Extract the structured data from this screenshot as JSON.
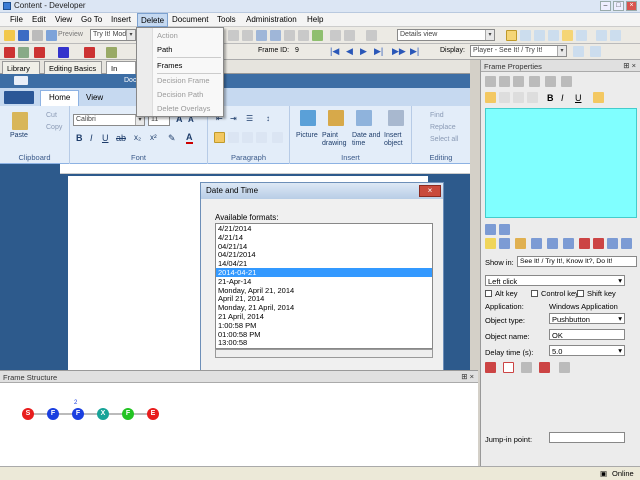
{
  "title": "Content - Developer",
  "menu": [
    "File",
    "Edit",
    "View",
    "Go To",
    "Insert",
    "Delete",
    "Document",
    "Tools",
    "Administration",
    "Help"
  ],
  "delete_menu": {
    "items": [
      {
        "label": "Action",
        "enabled": false
      },
      {
        "label": "Path",
        "enabled": true
      },
      {
        "label": "Frames",
        "enabled": true
      },
      {
        "label": "Decision Frame",
        "enabled": false
      },
      {
        "label": "Decision Path",
        "enabled": false
      },
      {
        "label": "Delete Overlays",
        "enabled": false
      }
    ]
  },
  "toolbar1": {
    "preview_label": "Preview",
    "mode_value": "Try It! Mode",
    "view_value": "Details view"
  },
  "toolbar2": {
    "frame_id_label": "Frame ID:",
    "frame_id_value": "9",
    "display_label": "Display:",
    "display_value": "Player - See It! / Try It!"
  },
  "doc_tabs": [
    "Library",
    "Editing Basics",
    "In"
  ],
  "word": {
    "tabs": [
      "Home",
      "View"
    ],
    "clipboard": {
      "paste": "Paste",
      "cut": "Cut",
      "copy": "Copy",
      "label": "Clipboard"
    },
    "font": {
      "name": "Calibri",
      "size": "11",
      "label": "Font"
    },
    "paragraph": {
      "label": "Paragraph"
    },
    "insert": {
      "picture": "Picture",
      "paint": "Paint drawing",
      "datetime": "Date and time",
      "object": "Insert object",
      "label": "Insert"
    },
    "editing": {
      "find": "Find",
      "replace": "Replace",
      "selectall": "Select all",
      "label": "Editing"
    },
    "doc_tab_label": "Doc"
  },
  "dialog": {
    "title": "Date and Time",
    "label": "Available formats:",
    "formats": [
      "4/21/2014",
      "4/21/14",
      "04/21/14",
      "04/21/2014",
      "14/04/21",
      "2014-04-21",
      "21-Apr-14",
      "Monday, April 21, 2014",
      "April 21, 2014",
      "Monday, 21 April, 2014",
      "21 April, 2014",
      "1:00:58 PM",
      "01:00:58 PM",
      "13:00:58"
    ],
    "selected_index": 5
  },
  "frame_properties": {
    "title": "Frame Properties",
    "show_in_label": "Show in:",
    "show_in_value": "See It! / Try It!, Know It?, Do It!",
    "action_value": "Left click",
    "alt_key": "Alt key",
    "control_key": "Control key",
    "shift_key": "Shift key",
    "application_label": "Application:",
    "application_value": "Windows Application",
    "object_type_label": "Object type:",
    "object_type_value": "Pushbutton",
    "object_name_label": "Object name:",
    "object_name_value": "OK",
    "delay_label": "Delay time (s):",
    "delay_value": "5.0",
    "jump_label": "Jump-in point:",
    "jump_value": ""
  },
  "frame_structure": {
    "title": "Frame Structure",
    "nodes": [
      {
        "label": "S",
        "color": "#e81c1c"
      },
      {
        "label": "F",
        "color": "#1a3fe0"
      },
      {
        "label": "F",
        "color": "#1a3fe0",
        "badge": "2"
      },
      {
        "label": "X",
        "color": "#17a398"
      },
      {
        "label": "F",
        "color": "#22c322"
      },
      {
        "label": "E",
        "color": "#e81c1c"
      }
    ]
  },
  "status": {
    "online": "Online"
  }
}
